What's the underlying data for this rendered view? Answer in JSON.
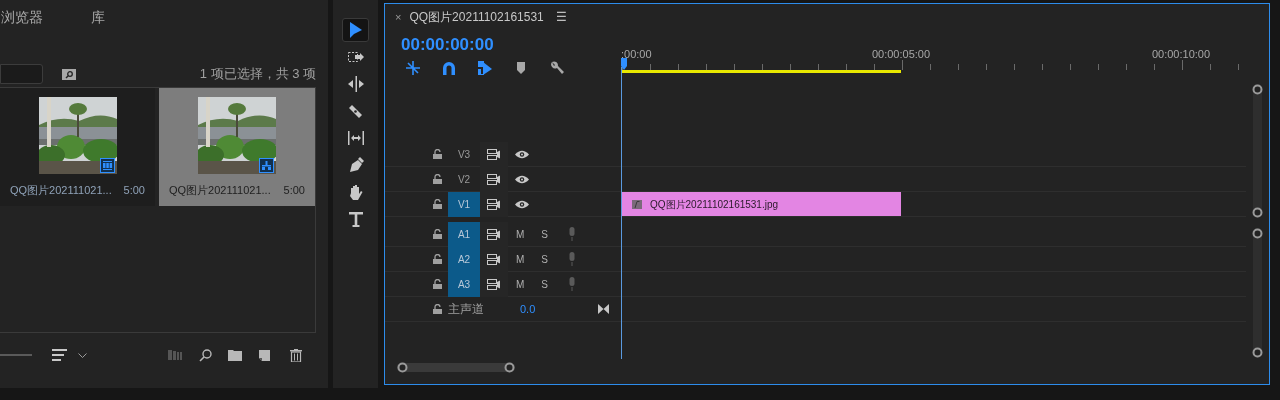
{
  "project_panel": {
    "tabs": [
      {
        "label": "浏览器",
        "selected": false
      },
      {
        "label": "库",
        "selected": false
      }
    ],
    "selection_count": "1 项已选择，共 3 项",
    "items": [
      {
        "name": "QQ图片202111021...",
        "duration": "5:00",
        "kind": "clip",
        "selected": false
      },
      {
        "name": "QQ图片202111021...",
        "duration": "5:00",
        "kind": "sequence",
        "selected": true
      }
    ]
  },
  "tools": [
    {
      "kind": "select",
      "selected": true
    },
    {
      "kind": "track-select",
      "selected": false
    },
    {
      "kind": "ripple",
      "selected": false
    },
    {
      "kind": "razor",
      "selected": false
    },
    {
      "kind": "slip",
      "selected": false
    },
    {
      "kind": "pen",
      "selected": false
    },
    {
      "kind": "hand",
      "selected": false
    },
    {
      "kind": "type",
      "selected": false
    }
  ],
  "timeline": {
    "close": "×",
    "title": "QQ图片20211102161531",
    "menu": "☰",
    "timecode": "00:00:00:00",
    "toggles": [
      {
        "kind": "nest",
        "on": true
      },
      {
        "kind": "snap",
        "on": true
      },
      {
        "kind": "linked",
        "on": true
      },
      {
        "kind": "marker",
        "on": false
      },
      {
        "kind": "wrench",
        "on": false
      }
    ],
    "ruler_labels": [
      ":00:00",
      "00:00:05:00",
      "00:00:10:00"
    ],
    "tracks": [
      {
        "kind": "video",
        "label": "V3",
        "targeted": false
      },
      {
        "kind": "video",
        "label": "V2",
        "targeted": false
      },
      {
        "kind": "video",
        "label": "V1",
        "targeted": true,
        "clip": "QQ图片20211102161531.jpg"
      },
      {
        "kind": "audio",
        "label": "A1",
        "targeted": true,
        "mute": "M",
        "solo": "S"
      },
      {
        "kind": "audio",
        "label": "A2",
        "targeted": true,
        "mute": "M",
        "solo": "S"
      },
      {
        "kind": "audio",
        "label": "A3",
        "targeted": true,
        "mute": "M",
        "solo": "S"
      },
      {
        "kind": "master",
        "label": "主声道",
        "volume": "0.0"
      }
    ]
  }
}
